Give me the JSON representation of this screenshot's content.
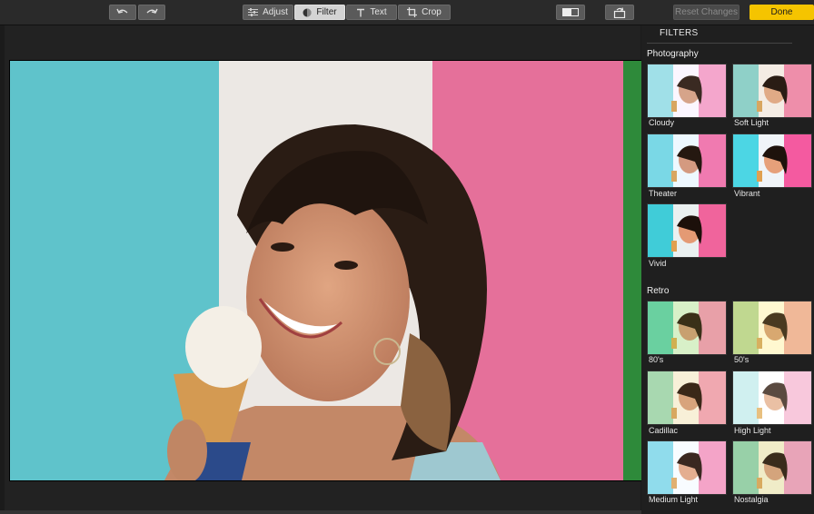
{
  "toolbar": {
    "undo_icon": "undo-icon",
    "redo_icon": "redo-icon",
    "tabs": [
      {
        "label": "Adjust",
        "icon": "sliders-icon"
      },
      {
        "label": "Filter",
        "icon": "filter-circle-icon"
      },
      {
        "label": "Text",
        "icon": "text-icon"
      },
      {
        "label": "Crop",
        "icon": "crop-icon"
      }
    ],
    "active_tab": "Filter",
    "compare_icon": "compare-icon",
    "rotate_icon": "rotate-icon",
    "reset_label": "Reset Changes",
    "done_label": "Done",
    "accent": "#f5c400"
  },
  "sidebar": {
    "title": "FILTERS",
    "sections": [
      {
        "label": "Photography",
        "filters": [
          "Cloudy",
          "Soft Light",
          "Theater",
          "Vibrant",
          "Vivid"
        ]
      },
      {
        "label": "Retro",
        "filters": [
          "80's",
          "50's",
          "Cadillac",
          "High Light",
          "Medium Light",
          "Nostalgia"
        ]
      }
    ]
  }
}
